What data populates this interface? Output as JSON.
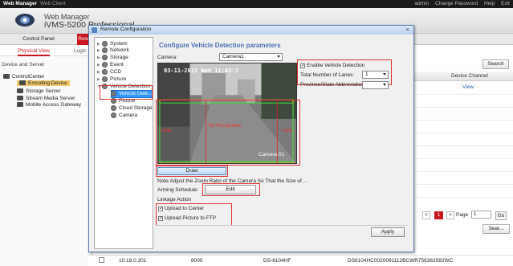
{
  "topbar": {
    "brand": "Web Manager",
    "client": "Web Client",
    "admin": "admin",
    "change_password": "Change Password",
    "help": "Help",
    "exit": "Exit"
  },
  "header": {
    "app_name": "Web Manager",
    "app_product": "iVMS-5200 Professional"
  },
  "nav": {
    "control_panel": "Control Panel",
    "resource": "Reso"
  },
  "subnav": {
    "physical": "Physical View",
    "logical": "Logic"
  },
  "left": {
    "section_title": "Device and Server",
    "root": "ControlCenter",
    "items": [
      "Encoding Device",
      "Storage Server",
      "Stream Media Server",
      "Mobile Access Gateway"
    ]
  },
  "right": {
    "search": "Search",
    "column_header": "Device Channel",
    "view_link": "View",
    "pager": {
      "prev": "<",
      "current": "1",
      "next": ">",
      "page_label": "Page",
      "page_value": "1",
      "go": "Go"
    },
    "search_short": "Sear..."
  },
  "bottom_row": {
    "ip": "10.18.0.201",
    "port": "8000",
    "model": "DS-6104HF",
    "serial": "DS6104HC0020091112BCWR756362582WC"
  },
  "dialog": {
    "title": "Remote Configuration",
    "close": "×",
    "tree": {
      "items": [
        "System",
        "Network",
        "Storage",
        "Event",
        "CCD",
        "Picture",
        "Vehicle Detection"
      ],
      "children": [
        "Vehicle Dete...",
        "Picture",
        "Cloud Storage",
        "Camera"
      ]
    },
    "config_title": "Configure Vehicle Detection parameters",
    "camera_label": "Camera:",
    "camera_value": "Camera1",
    "video": {
      "timestamp": "03-11-2015 Wed 11:43:3",
      "label": "Camera 01",
      "zone_left": "Lane",
      "zone_right": "Lane",
      "zone_center": "No Recognition"
    },
    "enable_label": "Enable Vehicle Detection",
    "enable_checked": true,
    "lanes_label": "Total Number of Lanes:",
    "lanes_value": "1",
    "province_label": "Province/State Abbreviation:",
    "province_value": "",
    "draw": "Draw",
    "note": "Note:Adjust the Zoom Ratio of the Camera So That the Size of ...",
    "arming_label": "Arming Schedule:",
    "edit": "Edit",
    "linkage_label": "Linkage Action",
    "upload_center": "Upload to Center",
    "upload_ftp": "Upload Picture to FTP",
    "apply": "Apply",
    "colors": {
      "accent": "#c9151e",
      "title_blue": "#4b6fb3",
      "selection": "#3399ff",
      "highlight": "#dd3333"
    }
  }
}
